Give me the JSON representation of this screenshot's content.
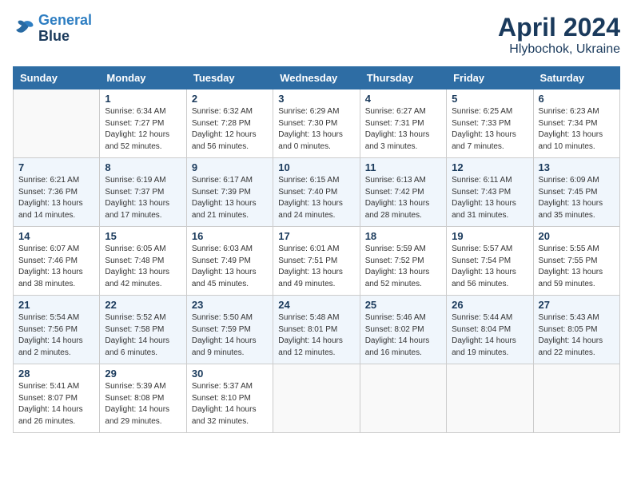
{
  "header": {
    "logo_line1": "General",
    "logo_line2": "Blue",
    "month": "April 2024",
    "location": "Hlybochok, Ukraine"
  },
  "columns": [
    "Sunday",
    "Monday",
    "Tuesday",
    "Wednesday",
    "Thursday",
    "Friday",
    "Saturday"
  ],
  "weeks": [
    [
      {
        "day": "",
        "info": ""
      },
      {
        "day": "1",
        "info": "Sunrise: 6:34 AM\nSunset: 7:27 PM\nDaylight: 12 hours\nand 52 minutes."
      },
      {
        "day": "2",
        "info": "Sunrise: 6:32 AM\nSunset: 7:28 PM\nDaylight: 12 hours\nand 56 minutes."
      },
      {
        "day": "3",
        "info": "Sunrise: 6:29 AM\nSunset: 7:30 PM\nDaylight: 13 hours\nand 0 minutes."
      },
      {
        "day": "4",
        "info": "Sunrise: 6:27 AM\nSunset: 7:31 PM\nDaylight: 13 hours\nand 3 minutes."
      },
      {
        "day": "5",
        "info": "Sunrise: 6:25 AM\nSunset: 7:33 PM\nDaylight: 13 hours\nand 7 minutes."
      },
      {
        "day": "6",
        "info": "Sunrise: 6:23 AM\nSunset: 7:34 PM\nDaylight: 13 hours\nand 10 minutes."
      }
    ],
    [
      {
        "day": "7",
        "info": "Sunrise: 6:21 AM\nSunset: 7:36 PM\nDaylight: 13 hours\nand 14 minutes."
      },
      {
        "day": "8",
        "info": "Sunrise: 6:19 AM\nSunset: 7:37 PM\nDaylight: 13 hours\nand 17 minutes."
      },
      {
        "day": "9",
        "info": "Sunrise: 6:17 AM\nSunset: 7:39 PM\nDaylight: 13 hours\nand 21 minutes."
      },
      {
        "day": "10",
        "info": "Sunrise: 6:15 AM\nSunset: 7:40 PM\nDaylight: 13 hours\nand 24 minutes."
      },
      {
        "day": "11",
        "info": "Sunrise: 6:13 AM\nSunset: 7:42 PM\nDaylight: 13 hours\nand 28 minutes."
      },
      {
        "day": "12",
        "info": "Sunrise: 6:11 AM\nSunset: 7:43 PM\nDaylight: 13 hours\nand 31 minutes."
      },
      {
        "day": "13",
        "info": "Sunrise: 6:09 AM\nSunset: 7:45 PM\nDaylight: 13 hours\nand 35 minutes."
      }
    ],
    [
      {
        "day": "14",
        "info": "Sunrise: 6:07 AM\nSunset: 7:46 PM\nDaylight: 13 hours\nand 38 minutes."
      },
      {
        "day": "15",
        "info": "Sunrise: 6:05 AM\nSunset: 7:48 PM\nDaylight: 13 hours\nand 42 minutes."
      },
      {
        "day": "16",
        "info": "Sunrise: 6:03 AM\nSunset: 7:49 PM\nDaylight: 13 hours\nand 45 minutes."
      },
      {
        "day": "17",
        "info": "Sunrise: 6:01 AM\nSunset: 7:51 PM\nDaylight: 13 hours\nand 49 minutes."
      },
      {
        "day": "18",
        "info": "Sunrise: 5:59 AM\nSunset: 7:52 PM\nDaylight: 13 hours\nand 52 minutes."
      },
      {
        "day": "19",
        "info": "Sunrise: 5:57 AM\nSunset: 7:54 PM\nDaylight: 13 hours\nand 56 minutes."
      },
      {
        "day": "20",
        "info": "Sunrise: 5:55 AM\nSunset: 7:55 PM\nDaylight: 13 hours\nand 59 minutes."
      }
    ],
    [
      {
        "day": "21",
        "info": "Sunrise: 5:54 AM\nSunset: 7:56 PM\nDaylight: 14 hours\nand 2 minutes."
      },
      {
        "day": "22",
        "info": "Sunrise: 5:52 AM\nSunset: 7:58 PM\nDaylight: 14 hours\nand 6 minutes."
      },
      {
        "day": "23",
        "info": "Sunrise: 5:50 AM\nSunset: 7:59 PM\nDaylight: 14 hours\nand 9 minutes."
      },
      {
        "day": "24",
        "info": "Sunrise: 5:48 AM\nSunset: 8:01 PM\nDaylight: 14 hours\nand 12 minutes."
      },
      {
        "day": "25",
        "info": "Sunrise: 5:46 AM\nSunset: 8:02 PM\nDaylight: 14 hours\nand 16 minutes."
      },
      {
        "day": "26",
        "info": "Sunrise: 5:44 AM\nSunset: 8:04 PM\nDaylight: 14 hours\nand 19 minutes."
      },
      {
        "day": "27",
        "info": "Sunrise: 5:43 AM\nSunset: 8:05 PM\nDaylight: 14 hours\nand 22 minutes."
      }
    ],
    [
      {
        "day": "28",
        "info": "Sunrise: 5:41 AM\nSunset: 8:07 PM\nDaylight: 14 hours\nand 26 minutes."
      },
      {
        "day": "29",
        "info": "Sunrise: 5:39 AM\nSunset: 8:08 PM\nDaylight: 14 hours\nand 29 minutes."
      },
      {
        "day": "30",
        "info": "Sunrise: 5:37 AM\nSunset: 8:10 PM\nDaylight: 14 hours\nand 32 minutes."
      },
      {
        "day": "",
        "info": ""
      },
      {
        "day": "",
        "info": ""
      },
      {
        "day": "",
        "info": ""
      },
      {
        "day": "",
        "info": ""
      }
    ]
  ]
}
